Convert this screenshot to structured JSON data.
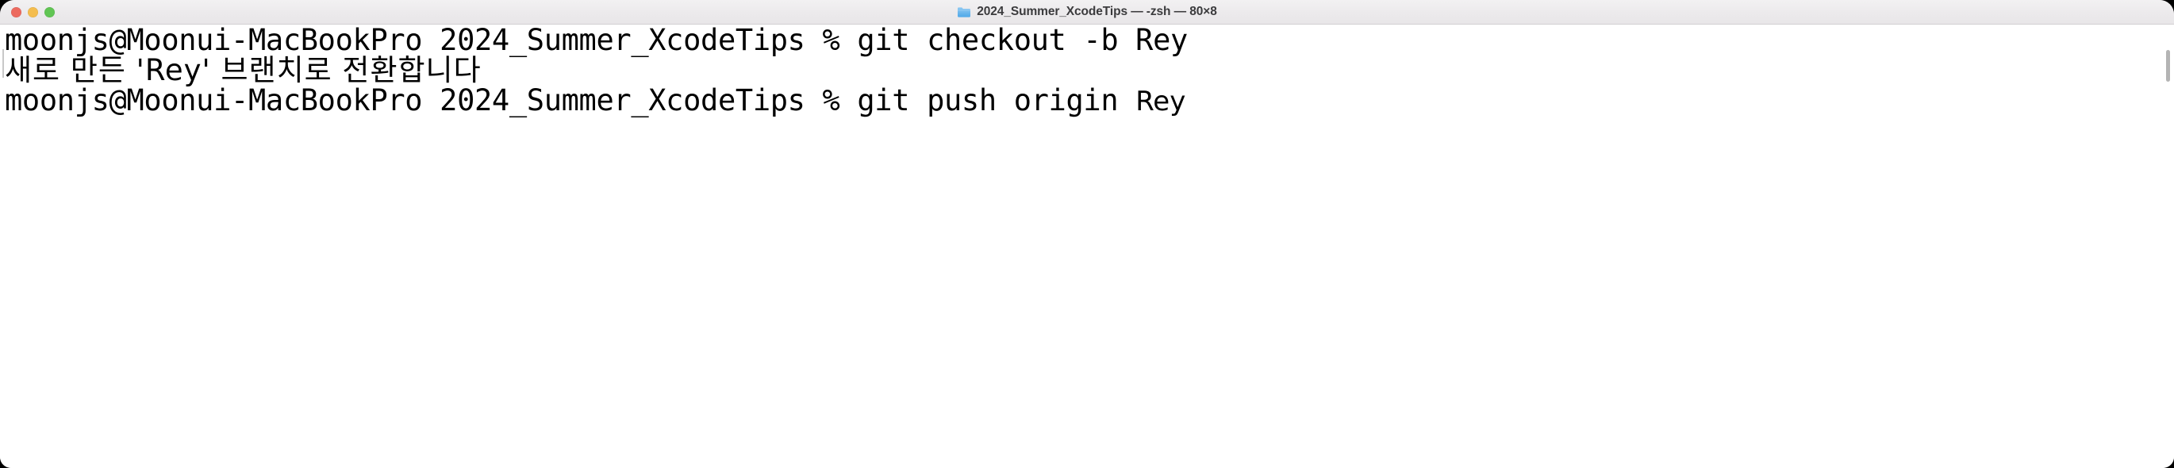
{
  "window": {
    "title": "2024_Summer_XcodeTips — -zsh — 80×8",
    "folder_icon": "folder-icon",
    "traffic_lights": [
      {
        "name": "close-button",
        "label": "Close",
        "color": "#ec6a5f"
      },
      {
        "name": "minimize-button",
        "label": "Minimize",
        "color": "#f4bd4f"
      },
      {
        "name": "maximize-button",
        "label": "Maximize",
        "color": "#61c554"
      }
    ]
  },
  "terminal": {
    "background_color": "#ffffff",
    "text_color": "#000000",
    "lines": [
      {
        "id": "prompt-line-1",
        "kind": "command",
        "prompt": "moonjs@Moonui-MacBookPro 2024_Summer_XcodeTips % ",
        "command": "git checkout -b Rey",
        "full_text": "moonjs@Moonui-MacBookPro 2024_Summer_XcodeTips % git checkout -b Rey"
      },
      {
        "id": "output-line-1",
        "kind": "output",
        "full_text": "새로 만든 'Rey' 브랜치로 전환합니다"
      },
      {
        "id": "prompt-line-2",
        "kind": "command",
        "prompt": "moonjs@Moonui-MacBookPro 2024_Summer_XcodeTips % ",
        "command": "git push origin ",
        "command_tail": "Rey",
        "full_text": "moonjs@Moonui-MacBookPro 2024_Summer_XcodeTips % git push origin Rey"
      }
    ],
    "scrollbar": {
      "name": "vertical-scrollbar",
      "visible": true
    }
  }
}
